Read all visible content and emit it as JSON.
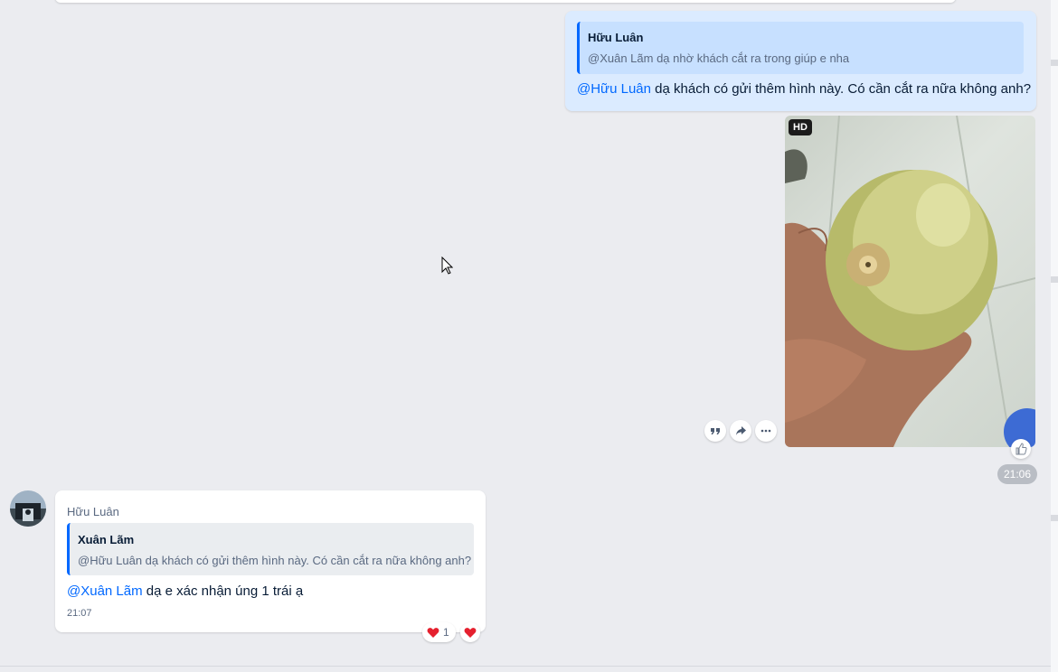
{
  "outgoing_message": {
    "quote_author": "Hữu Luân",
    "quote_text": "@Xuân Lãm dạ nhờ khách cắt ra trong giúp e nha",
    "mention": "@Hữu Luân",
    "text": " dạ khách có gửi thêm hình này. Có cần cắt ra nữa không anh?"
  },
  "photo": {
    "badge": "HD",
    "time": "21:06"
  },
  "message_actions": [
    "quote-icon",
    "forward-icon",
    "more-icon"
  ],
  "incoming_message": {
    "sender": "Hữu Luân",
    "quote_author": "Xuân Lãm",
    "quote_text": "@Hữu Luân dạ khách có gửi thêm hình này. Có cần cắt ra nữa không anh?",
    "mention": "@Xuân Lãm",
    "text": " dạ e xác nhận úng 1 trái ạ",
    "time": "21:07",
    "reaction_count": "1"
  },
  "colors": {
    "background": "#ebecf0",
    "outgoing_bubble": "#dbebff",
    "accent": "#0068ff",
    "heart": "#e5202e"
  }
}
